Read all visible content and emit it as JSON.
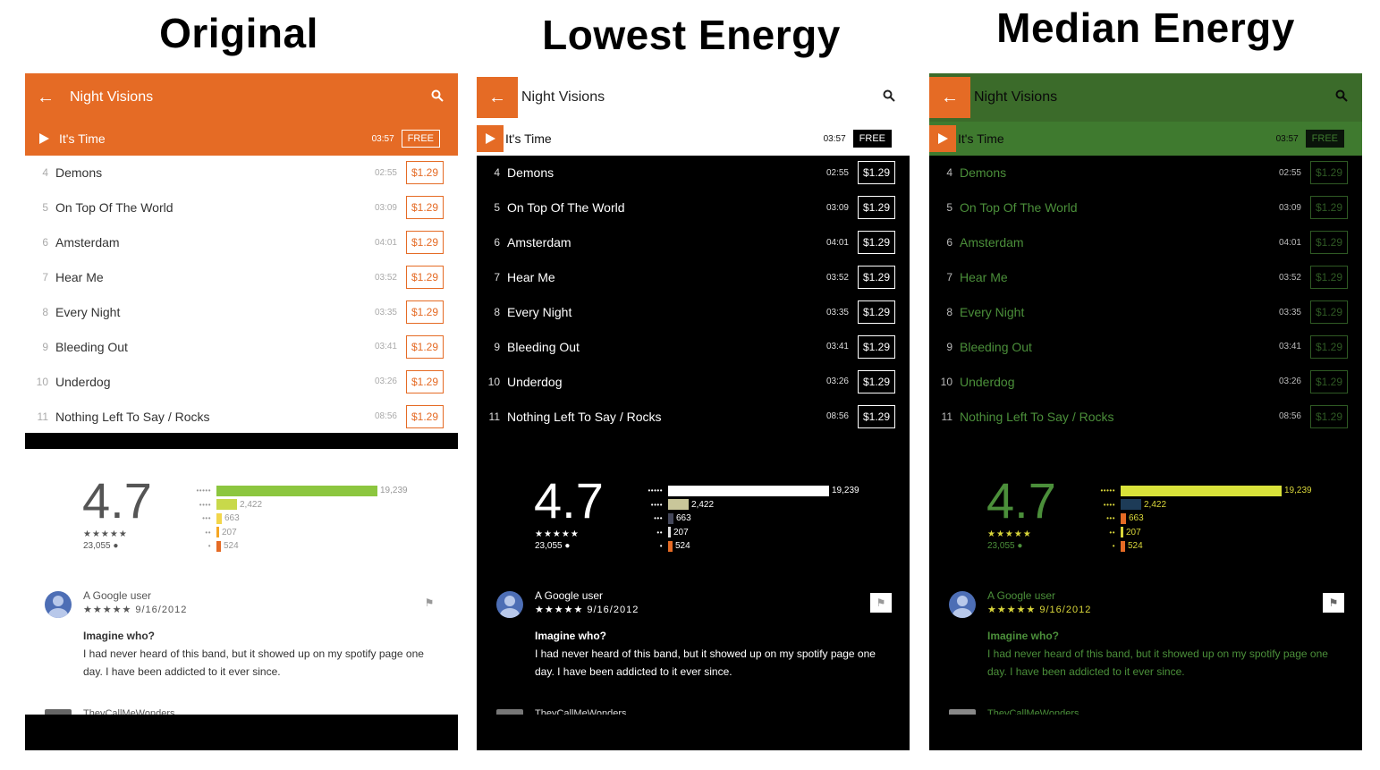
{
  "captions": {
    "original": "Original",
    "lowest": "Lowest Energy",
    "median": "Median Energy"
  },
  "app": {
    "album_title": "Night Visions",
    "now_playing": {
      "name": "It's Time",
      "duration": "03:57",
      "price": "FREE"
    },
    "tracks": [
      {
        "num": "4",
        "name": "Demons",
        "duration": "02:55",
        "price": "$1.29"
      },
      {
        "num": "5",
        "name": "On Top Of The World",
        "duration": "03:09",
        "price": "$1.29"
      },
      {
        "num": "6",
        "name": "Amsterdam",
        "duration": "04:01",
        "price": "$1.29"
      },
      {
        "num": "7",
        "name": "Hear Me",
        "duration": "03:52",
        "price": "$1.29"
      },
      {
        "num": "8",
        "name": "Every Night",
        "duration": "03:35",
        "price": "$1.29"
      },
      {
        "num": "9",
        "name": "Bleeding Out",
        "duration": "03:41",
        "price": "$1.29"
      },
      {
        "num": "10",
        "name": "Underdog",
        "duration": "03:26",
        "price": "$1.29"
      },
      {
        "num": "11",
        "name": "Nothing Left To Say / Rocks",
        "duration": "08:56",
        "price": "$1.29"
      }
    ],
    "rating": {
      "score": "4.7",
      "stars": "★★★★★",
      "total": "23,055",
      "breakdown": [
        {
          "stars": "•••••",
          "count": "19,239",
          "fraction": 1.0
        },
        {
          "stars": "••••",
          "count": "2,422",
          "fraction": 0.13
        },
        {
          "stars": "•••",
          "count": "663",
          "fraction": 0.035
        },
        {
          "stars": "••",
          "count": "207",
          "fraction": 0.012
        },
        {
          "stars": "•",
          "count": "524",
          "fraction": 0.027
        }
      ]
    },
    "review": {
      "user": "A Google user",
      "stars": "★★★★★",
      "date": "9/16/2012",
      "title": "Imagine who?",
      "body": "I had never heard of this band, but it showed up on my spotify page one day. I have been addicted to it ever since.",
      "next_user": "TheyCallMeWonders"
    }
  },
  "icons": {
    "back": "arrow-left-icon",
    "search": "search-icon",
    "play": "play-icon",
    "flag": "flag-icon"
  },
  "colors": {
    "orange": "#e56b25",
    "bar_orig": [
      "#8cc63f",
      "#c8d94a",
      "#f2d64b",
      "#f5a623",
      "#e56b25"
    ],
    "bar_low": [
      "#ffffff",
      "#c9c69a",
      "#44475a",
      "#e0e0e0",
      "#e56b25"
    ],
    "bar_med": [
      "#d9e23a",
      "#1d3b57",
      "#e56b25",
      "#d9d63a",
      "#e56b25"
    ]
  }
}
